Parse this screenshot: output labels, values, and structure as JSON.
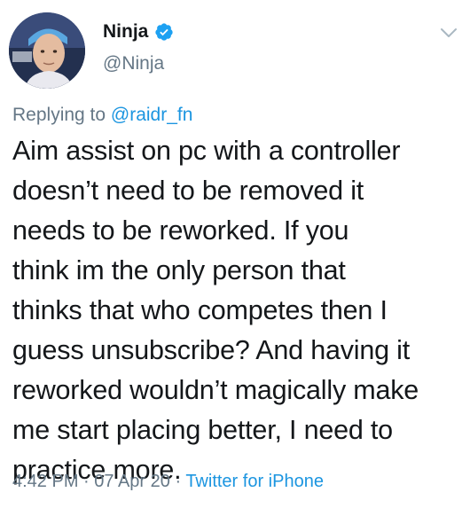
{
  "author": {
    "display_name": "Ninja",
    "handle": "@Ninja",
    "verified": true,
    "avatar_icon": "profile-photo"
  },
  "reply": {
    "prefix": "Replying to ",
    "mention": "@raidr_fn"
  },
  "tweet": {
    "text": "Aim assist on pc with a controller\ndoesn’t need to be removed it\nneeds to be reworked. If you\nthink im the only person that\nthinks that who competes then I\nguess unsubscribe? And having it\nreworked wouldn’t magically make\nme start placing better, I need to\npractice more."
  },
  "meta": {
    "time": "4:42 PM",
    "separator_1": " · ",
    "date": "07 Apr 20",
    "separator_2": " · ",
    "source": "Twitter for iPhone"
  },
  "colors": {
    "text": "#14171a",
    "secondary": "#657786",
    "link": "#1b95e0",
    "verified": "#1da1f2"
  }
}
